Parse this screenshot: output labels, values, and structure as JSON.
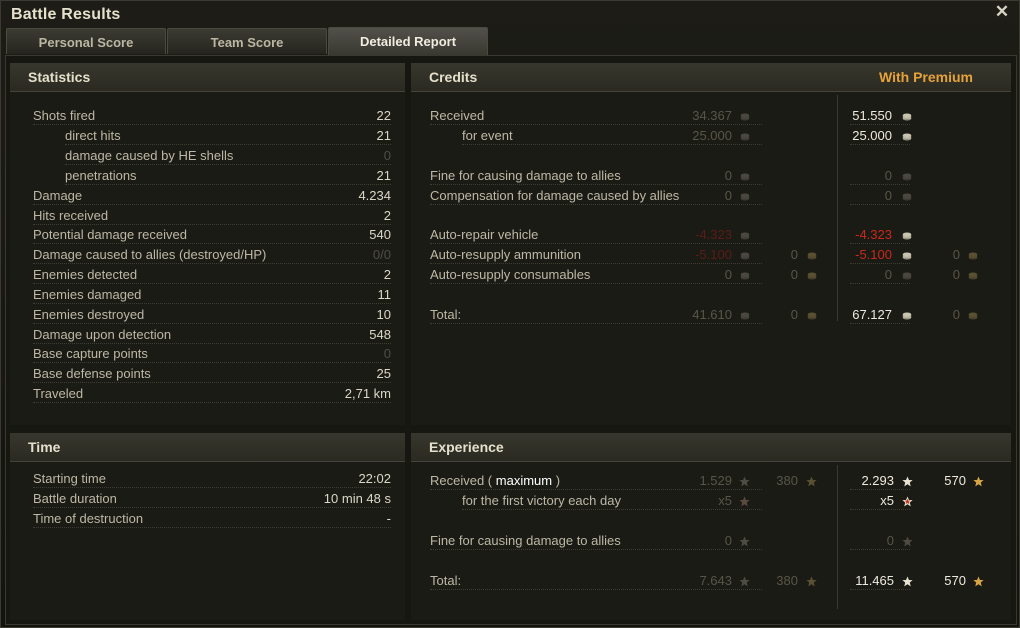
{
  "window": {
    "title": "Battle Results"
  },
  "tabs": [
    {
      "label": "Personal Score"
    },
    {
      "label": "Team Score"
    },
    {
      "label": "Detailed Report"
    }
  ],
  "statistics": {
    "title": "Statistics",
    "rows": [
      {
        "label": "Shots fired",
        "value": "22"
      },
      {
        "label": "direct hits",
        "value": "21"
      },
      {
        "label": "damage caused by HE shells",
        "value": "0"
      },
      {
        "label": "penetrations",
        "value": "21"
      },
      {
        "label": "Damage",
        "value": "4.234"
      },
      {
        "label": "Hits received",
        "value": "2"
      },
      {
        "label": "Potential damage received",
        "value": "540"
      },
      {
        "label": "Damage caused to allies (destroyed/HP)",
        "value": "0/0"
      },
      {
        "label": "Enemies detected",
        "value": "2"
      },
      {
        "label": "Enemies damaged",
        "value": "11"
      },
      {
        "label": "Enemies destroyed",
        "value": "10"
      },
      {
        "label": "Damage upon detection",
        "value": "548"
      },
      {
        "label": "Base capture points",
        "value": "0"
      },
      {
        "label": "Base defense points",
        "value": "25"
      },
      {
        "label": "Traveled",
        "value": "2,71 km"
      }
    ]
  },
  "time": {
    "title": "Time",
    "rows": [
      {
        "label": "Starting time",
        "value": "22:02"
      },
      {
        "label": "Battle duration",
        "value": "10 min 48 s"
      },
      {
        "label": "Time of destruction",
        "value": "-"
      }
    ]
  },
  "credits": {
    "title": "Credits",
    "premium_title": "With Premium",
    "rows": [
      {
        "label": "Received",
        "std": "34.367",
        "std_gold": "",
        "prem": "51.550",
        "prem_gold": ""
      },
      {
        "label": "for event",
        "std": "25.000",
        "std_gold": "",
        "prem": "25.000",
        "prem_gold": ""
      },
      {
        "label": "Fine for causing damage to allies",
        "std": "0",
        "std_gold": "",
        "prem": "0",
        "prem_gold": ""
      },
      {
        "label": "Compensation for damage caused by allies",
        "std": "0",
        "std_gold": "",
        "prem": "0",
        "prem_gold": ""
      },
      {
        "label": "Auto-repair vehicle",
        "std": "-4.323",
        "std_gold": "",
        "prem": "-4.323",
        "prem_gold": ""
      },
      {
        "label": "Auto-resupply ammunition",
        "std": "-5.100",
        "std_gold": "0",
        "prem": "-5.100",
        "prem_gold": "0"
      },
      {
        "label": "Auto-resupply consumables",
        "std": "0",
        "std_gold": "0",
        "prem": "0",
        "prem_gold": "0"
      },
      {
        "label": "Total:",
        "std": "41.610",
        "std_gold": "0",
        "prem": "67.127",
        "prem_gold": "0"
      }
    ]
  },
  "experience": {
    "title": "Experience",
    "received_label": "Received (",
    "received_max": "maximum",
    "received_close": ")",
    "rows": [
      {
        "label": "Received",
        "std": "1.529",
        "std_free": "380",
        "prem": "2.293",
        "prem_free": "570"
      },
      {
        "label": "for the first victory each day",
        "std": "x5",
        "std_free": "",
        "prem": "x5",
        "prem_free": ""
      },
      {
        "label": "Fine for causing damage to allies",
        "std": "0",
        "std_free": "",
        "prem": "0",
        "prem_free": ""
      },
      {
        "label": "Total:",
        "std": "7.643",
        "std_free": "380",
        "prem": "11.465",
        "prem_free": "570"
      }
    ]
  },
  "icons": {
    "credit": "credit-coin-icon",
    "gold": "gold-coin-icon",
    "xp": "xp-star-icon",
    "free_xp": "free-xp-star-icon",
    "close": "close-icon"
  },
  "colors": {
    "premium": "#e6a23a",
    "negative": "#c9291a"
  }
}
